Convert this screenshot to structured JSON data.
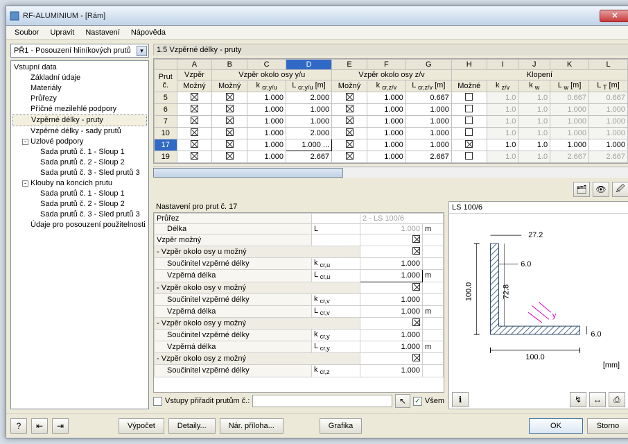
{
  "window": {
    "title": "RF-ALUMINIUM - [Rám]"
  },
  "menu": {
    "items": [
      "Soubor",
      "Upravit",
      "Nastavení",
      "Nápověda"
    ]
  },
  "left": {
    "combo": "PŘ1 - Posouzení hliníkových prutů",
    "tree": [
      {
        "text": "Vstupní data",
        "depth": 0
      },
      {
        "text": "Základní údaje",
        "depth": 1
      },
      {
        "text": "Materiály",
        "depth": 1
      },
      {
        "text": "Průřezy",
        "depth": 1
      },
      {
        "text": "Příčné mezilehlé podpory",
        "depth": 1
      },
      {
        "text": "Vzpěrné délky - pruty",
        "depth": 1,
        "selected": true
      },
      {
        "text": "Vzpěrné délky - sady prutů",
        "depth": 1
      },
      {
        "text": "Uzlové podpory",
        "depth": 1,
        "exp": "-"
      },
      {
        "text": "Sada prutů č. 1 - Sloup 1",
        "depth": 2
      },
      {
        "text": "Sada prutů č. 2 - Sloup 2",
        "depth": 2
      },
      {
        "text": "Sada prutů č. 3 - Sled prutů 3",
        "depth": 2
      },
      {
        "text": "Klouby na koncích prutu",
        "depth": 1,
        "exp": "-"
      },
      {
        "text": "Sada prutů č. 1 - Sloup 1",
        "depth": 2
      },
      {
        "text": "Sada prutů č. 2 - Sloup 2",
        "depth": 2
      },
      {
        "text": "Sada prutů č. 3 - Sled prutů 3",
        "depth": 2
      },
      {
        "text": "Údaje pro posouzení použitelnosti",
        "depth": 1
      }
    ]
  },
  "topgrid": {
    "title": "1.5 Vzpěrné délky - pruty",
    "cols": [
      "A",
      "B",
      "C",
      "D",
      "E",
      "F",
      "G",
      "H",
      "I",
      "J",
      "K",
      "L"
    ],
    "hdr_row1": {
      "prut": "Prut",
      "a": "Vzpěr",
      "yu": "Vzpěr okolo osy y/u",
      "zv": "Vzpěr okolo osy z/v",
      "kl": "Klopení"
    },
    "hdr_row2": {
      "c": "č.",
      "mozny": "Možný",
      "mozny2": "Možný",
      "kcr_yu": "k cr,y/u",
      "lcr_yu": "L cr,y/u [m]",
      "mozny3": "Možný",
      "kcr_zv": "k cr,z/v",
      "lcr_zv": "L cr,z/v [m]",
      "mozne": "Možné",
      "kzv": "k z/v",
      "kw": "k w",
      "lw": "L w [m]",
      "lt": "L T [m]"
    },
    "rows": [
      {
        "n": "5",
        "a": true,
        "b": true,
        "c": "1.000",
        "d": "2.000",
        "e": true,
        "f": "1.000",
        "g": "0.667",
        "h": false,
        "i": "1.0",
        "j": "1.0",
        "k": "0.667",
        "l": "0.667",
        "gray": true
      },
      {
        "n": "6",
        "a": true,
        "b": true,
        "c": "1.000",
        "d": "1.000",
        "e": true,
        "f": "1.000",
        "g": "1.000",
        "h": false,
        "i": "1.0",
        "j": "1.0",
        "k": "1.000",
        "l": "1.000",
        "gray": true
      },
      {
        "n": "7",
        "a": true,
        "b": true,
        "c": "1.000",
        "d": "1.000",
        "e": true,
        "f": "1.000",
        "g": "1.000",
        "h": false,
        "i": "1.0",
        "j": "1.0",
        "k": "1.000",
        "l": "1.000",
        "gray": true
      },
      {
        "n": "10",
        "a": true,
        "b": true,
        "c": "1.000",
        "d": "2.000",
        "e": true,
        "f": "1.000",
        "g": "1.000",
        "h": false,
        "i": "1.0",
        "j": "1.0",
        "k": "1.000",
        "l": "1.000",
        "gray": true
      },
      {
        "n": "17",
        "a": true,
        "b": true,
        "c": "1.000",
        "d": "1.000 ...",
        "e": true,
        "f": "1.000",
        "g": "1.000",
        "h": true,
        "i": "1.0",
        "j": "1.0",
        "k": "1.000",
        "l": "1.000",
        "sel": true
      },
      {
        "n": "19",
        "a": true,
        "b": true,
        "c": "1.000",
        "d": "2.667",
        "e": true,
        "f": "1.000",
        "g": "2.667",
        "h": false,
        "i": "1.0",
        "j": "1.0",
        "k": "2.667",
        "l": "2.667",
        "gray": true
      }
    ]
  },
  "settings": {
    "title": "Nastavení pro prut č. 17",
    "rows": [
      {
        "label": "Průřez",
        "sym": "",
        "val": "2 - LS 100/6",
        "unit": "",
        "gray": true,
        "span": true
      },
      {
        "label": "Délka",
        "sym": "L",
        "val": "1.000",
        "unit": "m",
        "gray": true
      },
      {
        "label": "Vzpěr možný",
        "sym": "",
        "val": "[x]",
        "unit": "",
        "chk": true
      },
      {
        "label": "Vzpěr okolo osy u možný",
        "section": true,
        "chk": true,
        "exp": "-"
      },
      {
        "label": "Součinitel vzpěrné délky",
        "sym": "k cr,u",
        "val": "1.000",
        "unit": ""
      },
      {
        "label": "Vzpěrná délka",
        "sym": "L cr,u",
        "val": "1.000",
        "unit": "m",
        "editing": true
      },
      {
        "label": "Vzpěr okolo osy v možný",
        "section": true,
        "chk": true,
        "exp": "-"
      },
      {
        "label": "Součinitel vzpěrné délky",
        "sym": "k cr,v",
        "val": "1.000",
        "unit": ""
      },
      {
        "label": "Vzpěrná délka",
        "sym": "L cr,v",
        "val": "1.000",
        "unit": "m"
      },
      {
        "label": "Vzpěr okolo osy y možný",
        "section": true,
        "chk": true,
        "exp": "-"
      },
      {
        "label": "Součinitel vzpěrné délky",
        "sym": "k cr,y",
        "val": "1.000",
        "unit": ""
      },
      {
        "label": "Vzpěrná délka",
        "sym": "L cr,y",
        "val": "1.000",
        "unit": "m"
      },
      {
        "label": "Vzpěr okolo osy z možný",
        "section": true,
        "chk": true,
        "exp": "-"
      },
      {
        "label": "Součinitel vzpěrné délky",
        "sym": "k cr,z",
        "val": "1.000",
        "unit": ""
      }
    ],
    "assign_label": "Vstupy přiřadit prutům č.:",
    "all_label": "Všem"
  },
  "section_panel": {
    "title": "LS 100/6",
    "dims": {
      "w": "100.0",
      "h": "100.0",
      "t1": "6.0",
      "t2": "6.0",
      "off": "27.2",
      "inner": "72.8"
    },
    "unit": "[mm]"
  },
  "footer": {
    "btn_calc": "Výpočet",
    "btn_details": "Detaily...",
    "btn_annex": "Nár. příloha...",
    "btn_graph": "Grafika",
    "btn_ok": "OK",
    "btn_cancel": "Storno"
  }
}
